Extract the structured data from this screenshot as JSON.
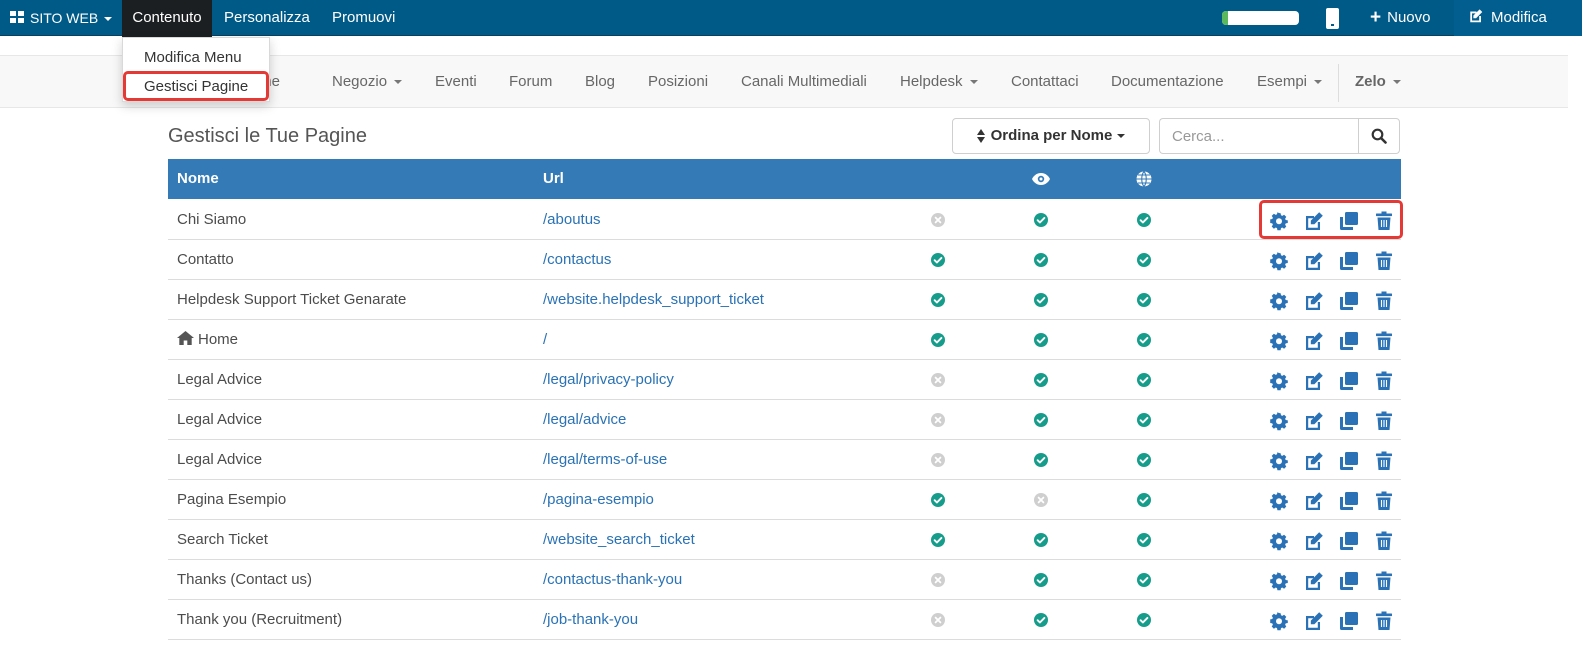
{
  "topbar": {
    "apps_label": "SITO WEB",
    "contenuto_label": "Contenuto",
    "personalizza_label": "Personalizza",
    "promuovi_label": "Promuovi",
    "nuovo_label": "Nuovo",
    "modifica_label": "Modifica",
    "toggle_fill_percent": 8
  },
  "dropdown": {
    "items": [
      "Modifica Menu",
      "Gestisci Pagine"
    ]
  },
  "navbar": {
    "items": [
      "Home",
      "Negozio",
      "Eventi",
      "Forum",
      "Blog",
      "Posizioni",
      "Canali Multimediali",
      "Helpdesk",
      "Contattaci",
      "Documentazione",
      "Esempi"
    ],
    "user_label": "Zelo"
  },
  "page": {
    "title": "Gestisci le Tue Pagine",
    "sort_label": "Ordina per Nome",
    "search_placeholder": "Cerca..."
  },
  "table": {
    "columns": [
      "Nome",
      "Url"
    ],
    "header_icons": [
      "eye-icon",
      "globe-icon"
    ],
    "rows": [
      {
        "name": "Chi Siamo",
        "url": "/aboutus",
        "s1": false,
        "s2": true,
        "s3": true
      },
      {
        "name": "Contatto",
        "url": "/contactus",
        "s1": true,
        "s2": true,
        "s3": true
      },
      {
        "name": "Helpdesk Support Ticket Genarate",
        "url": "/website.helpdesk_support_ticket",
        "s1": true,
        "s2": true,
        "s3": true
      },
      {
        "name": "Home",
        "url": "/",
        "s1": true,
        "s2": true,
        "s3": true,
        "home": true
      },
      {
        "name": "Legal Advice",
        "url": "/legal/privacy-policy",
        "s1": false,
        "s2": true,
        "s3": true
      },
      {
        "name": "Legal Advice",
        "url": "/legal/advice",
        "s1": false,
        "s2": true,
        "s3": true
      },
      {
        "name": "Legal Advice",
        "url": "/legal/terms-of-use",
        "s1": false,
        "s2": true,
        "s3": true
      },
      {
        "name": "Pagina Esempio",
        "url": "/pagina-esempio",
        "s1": true,
        "s2": false,
        "s3": true
      },
      {
        "name": "Search Ticket",
        "url": "/website_search_ticket",
        "s1": true,
        "s2": true,
        "s3": true
      },
      {
        "name": "Thanks (Contact us)",
        "url": "/contactus-thank-you",
        "s1": false,
        "s2": true,
        "s3": true
      },
      {
        "name": "Thank you (Recruitment)",
        "url": "/job-thank-you",
        "s1": false,
        "s2": true,
        "s3": true
      }
    ]
  },
  "colors": {
    "topbar": "#005a87",
    "table_header": "#337ab7",
    "ok": "#169c8b",
    "off": "#cfcfcf",
    "action": "#2a72b5",
    "highlight": "#e53935"
  }
}
